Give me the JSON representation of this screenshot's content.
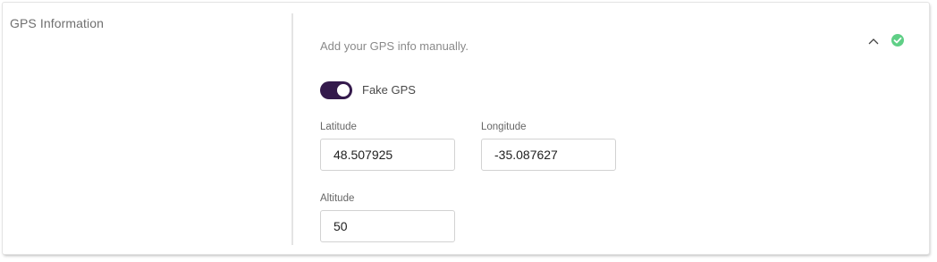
{
  "section": {
    "title": "GPS Information",
    "description": "Add your GPS info manually."
  },
  "icons": {
    "collapse": "chevron-up-icon",
    "status": "check-circle-icon",
    "status_color": "#5fcf86"
  },
  "toggle": {
    "label": "Fake GPS",
    "checked": true,
    "color": "#341a4c"
  },
  "fields": {
    "latitude": {
      "label": "Latitude",
      "value": "48.507925"
    },
    "longitude": {
      "label": "Longitude",
      "value": "-35.087627"
    },
    "altitude": {
      "label": "Altitude",
      "value": "50"
    }
  }
}
